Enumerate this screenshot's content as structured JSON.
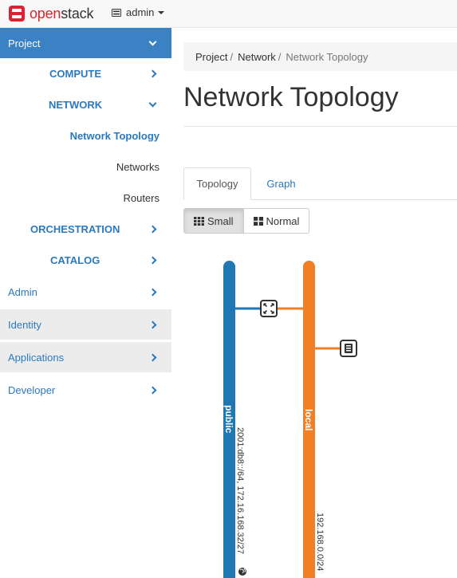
{
  "brand": {
    "name_red": "open",
    "name_dark": "stack"
  },
  "project_switcher": {
    "label": "admin"
  },
  "sidebar": {
    "project": "Project",
    "compute": "COMPUTE",
    "network": "NETWORK",
    "network_topology": "Network Topology",
    "networks": "Networks",
    "routers": "Routers",
    "orchestration": "ORCHESTRATION",
    "catalog": "CATALOG",
    "admin": "Admin",
    "identity": "Identity",
    "applications": "Applications",
    "developer": "Developer"
  },
  "breadcrumb": {
    "level1": "Project",
    "level2": "Network",
    "current": "Network Topology",
    "separator": "/"
  },
  "page": {
    "title": "Network Topology"
  },
  "tabs": {
    "topology": "Topology",
    "graph": "Graph"
  },
  "view_buttons": {
    "small": "Small",
    "normal": "Normal"
  },
  "topology": {
    "networks": [
      {
        "name": "public",
        "color": "#1f77b4",
        "subnets": "2001:db8::/64, 172.16.168.32/27"
      },
      {
        "name": "local",
        "color": "#f07f25",
        "subnets": "192.168.0.0/24"
      }
    ],
    "router_icon": "router-icon",
    "instance_icon": "instance-icon",
    "globe_icon": "globe-icon"
  },
  "colors": {
    "accent": "#2b79bd",
    "active_section": "#3b82c4",
    "public_net": "#1f77b4",
    "local_net": "#f07f25",
    "brand_red": "#d9232e"
  }
}
